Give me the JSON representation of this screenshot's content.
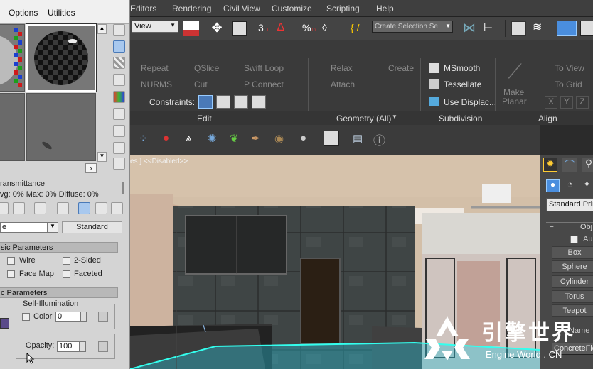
{
  "material_editor": {
    "menu": [
      "Options",
      "Utilities"
    ],
    "transmittance_label": "ransmittance",
    "stats": {
      "avg_label": "vg:",
      "avg": "0%",
      "max_label": "Max:",
      "max": "0%",
      "diffuse_label": "Diffuse:",
      "diffuse": "0%"
    },
    "material_name": "e",
    "material_type": "Standard",
    "basic_params": {
      "title": "sic Parameters",
      "wire": "Wire",
      "two_sided": "2-Sided",
      "face_map": "Face Map",
      "faceted": "Faceted"
    },
    "c_params": {
      "title": "c Parameters",
      "self_illum": "Self-Illumination",
      "color_label": "Color",
      "color_value": "0",
      "opacity_label": "Opacity:",
      "opacity_value": "100"
    }
  },
  "main_menu": [
    "Editors",
    "Rendering",
    "Civil View",
    "Customize",
    "Scripting",
    "Help"
  ],
  "toolbar": {
    "view_dropdown": "View",
    "selection_set": "Create Selection Se"
  },
  "ribbon": {
    "row1": {
      "repeat": "Repeat",
      "qslice": "QSlice",
      "swift_loop": "Swift Loop",
      "relax": "Relax",
      "create": "Create",
      "msmooth": "MSmooth",
      "to_view": "To View"
    },
    "row2": {
      "nurms": "NURMS",
      "cut": "Cut",
      "p_connect": "P Connect",
      "attach": "Attach",
      "tessellate": "Tessellate",
      "to_grid": "To Grid"
    },
    "row3": {
      "constraints": "Constraints:",
      "use_displac": "Use Displac..."
    },
    "make_planar": [
      "Make",
      "Planar"
    ],
    "xyz": [
      "X",
      "Y",
      "Z"
    ],
    "sections": {
      "edit": "Edit",
      "geometry": "Geometry (All)",
      "subdivision": "Subdivision",
      "align": "Align"
    }
  },
  "viewport": {
    "label": "es ] <<Disabled>>"
  },
  "command_panel": {
    "category": "Standard Prim",
    "rollout": "Obj",
    "autogrid": "Au",
    "buttons": [
      "Box",
      "Sphere",
      "Cylinder",
      "Torus",
      "Teapot"
    ],
    "name_rollout": "Name",
    "name_value": "ConcreteFlo"
  },
  "watermark": {
    "cn": "引擎世界",
    "en": "Engine World . CN"
  },
  "colors": {
    "ui_dark": "#3a3a3a",
    "active_blue": "#4a8ede",
    "watermark": "#ffffff"
  }
}
